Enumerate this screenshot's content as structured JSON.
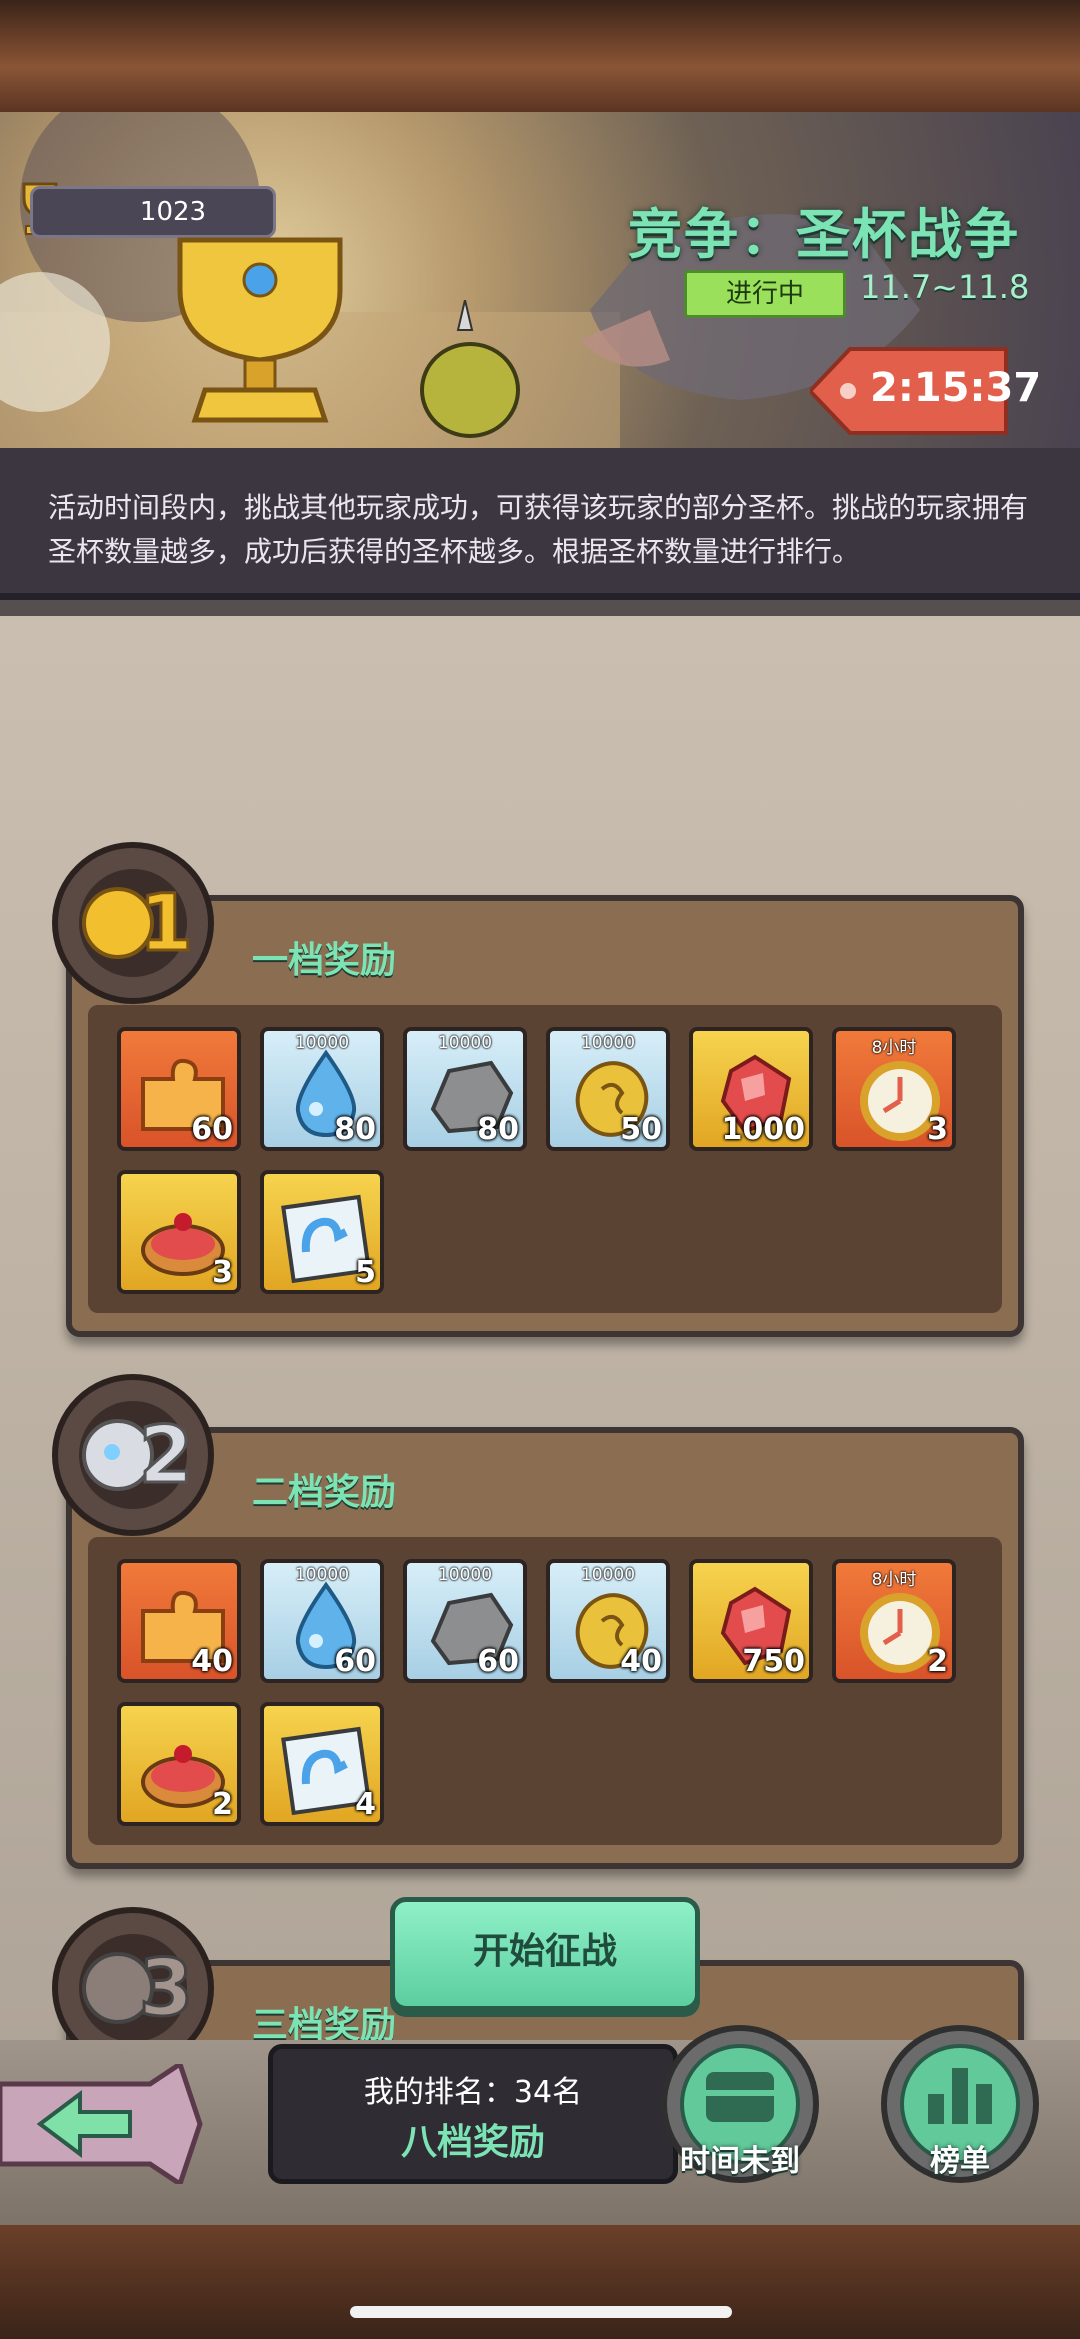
{
  "header": {
    "trophy_count": "1023",
    "event_title": "竞争：圣杯战争",
    "status": "进行中",
    "date_range": "11.7~11.8",
    "countdown": "2:15:37",
    "description": "活动时间段内，挑战其他玩家成功，可获得该玩家的部分圣杯。挑战的玩家拥有圣杯数量越多，成功后获得的圣杯越多。根据圣杯数量进行排行。"
  },
  "tiers": [
    {
      "title": "一档奖励",
      "gear_number": "1",
      "items": [
        {
          "icon": "puzzle-piece-icon",
          "color": "orange",
          "top": "",
          "count": "60"
        },
        {
          "icon": "water-drop-icon",
          "color": "blue",
          "top": "10000",
          "count": "80"
        },
        {
          "icon": "stone-icon",
          "color": "blue",
          "top": "10000",
          "count": "80"
        },
        {
          "icon": "gold-coin-icon",
          "color": "blue",
          "top": "10000",
          "count": "50"
        },
        {
          "icon": "ruby-gem-icon",
          "color": "gold",
          "top": "",
          "count": "1000"
        },
        {
          "icon": "alarm-clock-icon",
          "color": "orange",
          "top": "8小时",
          "count": "3"
        },
        {
          "icon": "cherry-pie-icon",
          "color": "gold",
          "top": "",
          "count": "3"
        },
        {
          "icon": "muscle-poster-icon",
          "color": "gold",
          "top": "",
          "count": "5"
        }
      ]
    },
    {
      "title": "二档奖励",
      "gear_number": "2",
      "items": [
        {
          "icon": "puzzle-piece-icon",
          "color": "orange",
          "top": "",
          "count": "40"
        },
        {
          "icon": "water-drop-icon",
          "color": "blue",
          "top": "10000",
          "count": "60"
        },
        {
          "icon": "stone-icon",
          "color": "blue",
          "top": "10000",
          "count": "60"
        },
        {
          "icon": "gold-coin-icon",
          "color": "blue",
          "top": "10000",
          "count": "40"
        },
        {
          "icon": "ruby-gem-icon",
          "color": "gold",
          "top": "",
          "count": "750"
        },
        {
          "icon": "alarm-clock-icon",
          "color": "orange",
          "top": "8小时",
          "count": "2"
        },
        {
          "icon": "cherry-pie-icon",
          "color": "gold",
          "top": "",
          "count": "2"
        },
        {
          "icon": "muscle-poster-icon",
          "color": "gold",
          "top": "",
          "count": "4"
        }
      ]
    },
    {
      "title": "三档奖励",
      "gear_number": "3",
      "items": []
    }
  ],
  "actions": {
    "start_battle": "开始征战",
    "time_not_reached": "时间未到",
    "leaderboard": "榜单"
  },
  "rank": {
    "label": "我的排名：34名",
    "reward": "八档奖励"
  },
  "colors": {
    "accent_green": "#7be3b4",
    "status_green": "#9be05a",
    "timer_red": "#e2604b"
  }
}
